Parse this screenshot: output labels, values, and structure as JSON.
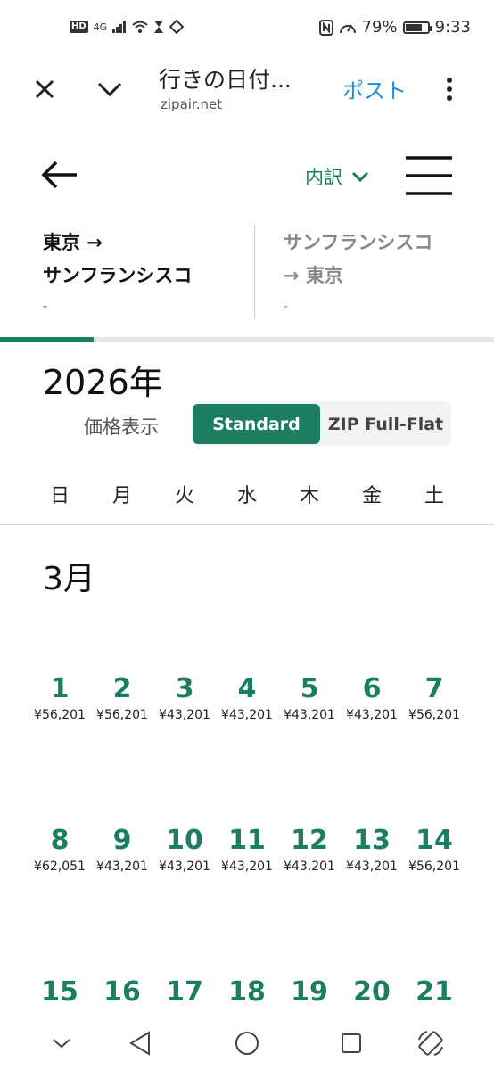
{
  "status_bar": {
    "network": "4G",
    "battery": "79%",
    "battery_level": 0.79,
    "time": "9:33"
  },
  "browser": {
    "page_title": "行きの日付...",
    "url": "zipair.net",
    "post_label": "ポスト"
  },
  "header": {
    "breakdown_label": "内訳"
  },
  "routes": [
    {
      "line1": "東京 →",
      "line2": "サンフランシスコ",
      "date": "-"
    },
    {
      "line1": "サンフランシスコ",
      "line2": "→ 東京",
      "date": "-"
    }
  ],
  "progress": 0.19,
  "calendar": {
    "year": "2026年",
    "price_label": "価格表示",
    "price_modes": [
      "Standard",
      "ZIP Full-Flat"
    ],
    "selected_mode": "Standard",
    "weekdays": [
      "日",
      "月",
      "火",
      "水",
      "木",
      "金",
      "土"
    ],
    "month": "3月",
    "weeks": [
      [
        {
          "day": "1",
          "price": "¥56,201"
        },
        {
          "day": "2",
          "price": "¥56,201"
        },
        {
          "day": "3",
          "price": "¥43,201"
        },
        {
          "day": "4",
          "price": "¥43,201"
        },
        {
          "day": "5",
          "price": "¥43,201"
        },
        {
          "day": "6",
          "price": "¥43,201"
        },
        {
          "day": "7",
          "price": "¥56,201"
        }
      ],
      [
        {
          "day": "8",
          "price": "¥62,051"
        },
        {
          "day": "9",
          "price": "¥43,201"
        },
        {
          "day": "10",
          "price": "¥43,201"
        },
        {
          "day": "11",
          "price": "¥43,201"
        },
        {
          "day": "12",
          "price": "¥43,201"
        },
        {
          "day": "13",
          "price": "¥43,201"
        },
        {
          "day": "14",
          "price": "¥56,201"
        }
      ],
      [
        {
          "day": "15",
          "price": ""
        },
        {
          "day": "16",
          "price": ""
        },
        {
          "day": "17",
          "price": ""
        },
        {
          "day": "18",
          "price": ""
        },
        {
          "day": "19",
          "price": ""
        },
        {
          "day": "20",
          "price": ""
        },
        {
          "day": "21",
          "price": ""
        }
      ]
    ]
  },
  "colors": {
    "accent": "#1b7e62",
    "link": "#1a8fdc"
  },
  "nav_icons": [
    "chevron-down-icon",
    "back-triangle-icon",
    "home-circle-icon",
    "recents-square-icon",
    "rotate-icon"
  ]
}
